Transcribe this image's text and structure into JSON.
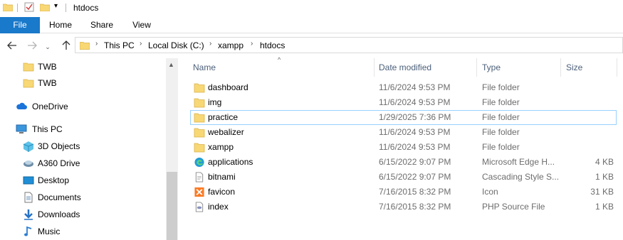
{
  "window": {
    "title": "htdocs"
  },
  "ribbon": {
    "tabs": [
      "File",
      "Home",
      "Share",
      "View"
    ]
  },
  "address": {
    "segments": [
      "This PC",
      "Local Disk (C:)",
      "xampp",
      "htdocs"
    ]
  },
  "sidebar": {
    "items": [
      {
        "label": "TWB",
        "icon": "folder-icon"
      },
      {
        "label": "TWB",
        "icon": "folder-icon"
      },
      {
        "label": "OneDrive",
        "icon": "cloud-icon"
      },
      {
        "label": "This PC",
        "icon": "computer-icon"
      },
      {
        "label": "3D Objects",
        "icon": "cube-icon"
      },
      {
        "label": "A360 Drive",
        "icon": "drive-icon"
      },
      {
        "label": "Desktop",
        "icon": "desktop-icon"
      },
      {
        "label": "Documents",
        "icon": "documents-icon"
      },
      {
        "label": "Downloads",
        "icon": "download-icon"
      },
      {
        "label": "Music",
        "icon": "music-icon"
      }
    ]
  },
  "columns": {
    "name": "Name",
    "date": "Date modified",
    "type": "Type",
    "size": "Size"
  },
  "files": [
    {
      "name": "dashboard",
      "date": "11/6/2024 9:53 PM",
      "type": "File folder",
      "size": "",
      "icon": "folder-icon"
    },
    {
      "name": "img",
      "date": "11/6/2024 9:53 PM",
      "type": "File folder",
      "size": "",
      "icon": "folder-icon"
    },
    {
      "name": "practice",
      "date": "1/29/2025 7:36 PM",
      "type": "File folder",
      "size": "",
      "icon": "folder-icon"
    },
    {
      "name": "webalizer",
      "date": "11/6/2024 9:53 PM",
      "type": "File folder",
      "size": "",
      "icon": "folder-icon"
    },
    {
      "name": "xampp",
      "date": "11/6/2024 9:53 PM",
      "type": "File folder",
      "size": "",
      "icon": "folder-icon"
    },
    {
      "name": "applications",
      "date": "6/15/2022 9:07 PM",
      "type": "Microsoft Edge H...",
      "size": "4 KB",
      "icon": "edge-icon"
    },
    {
      "name": "bitnami",
      "date": "6/15/2022 9:07 PM",
      "type": "Cascading Style S...",
      "size": "1 KB",
      "icon": "css-file-icon"
    },
    {
      "name": "favicon",
      "date": "7/16/2015 8:32 PM",
      "type": "Icon",
      "size": "31 KB",
      "icon": "xampp-icon"
    },
    {
      "name": "index",
      "date": "7/16/2015 8:32 PM",
      "type": "PHP Source File",
      "size": "1 KB",
      "icon": "php-file-icon"
    }
  ],
  "colors": {
    "accent": "#1979ca",
    "folder": "#f8d775",
    "selection_border": "#99d1ff"
  }
}
